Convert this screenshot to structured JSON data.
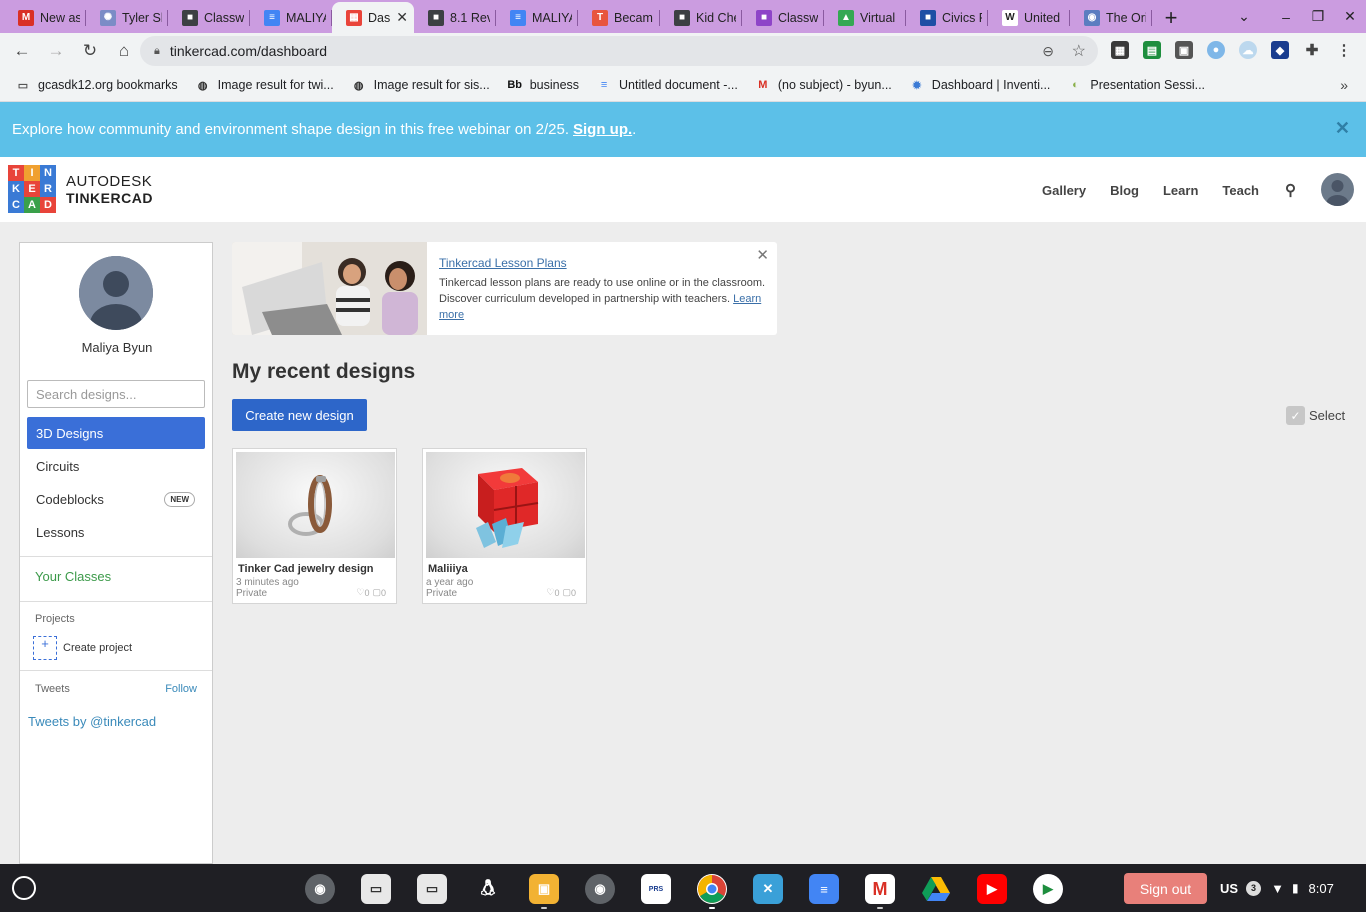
{
  "browser": {
    "tabs": [
      {
        "title": "New as",
        "icon": "gmail-icon",
        "color": "#d93025",
        "glyph": "M"
      },
      {
        "title": "Tyler Sl",
        "icon": "sparkle-icon",
        "color": "#7b8cc6",
        "glyph": "✺"
      },
      {
        "title": "Classw",
        "icon": "classroom-icon",
        "color": "#3c4043",
        "glyph": "■"
      },
      {
        "title": "MALIYA",
        "icon": "docs-icon",
        "color": "#4285f4",
        "glyph": "≡"
      },
      {
        "title": "Das",
        "icon": "tinkercad-icon",
        "color": "#e9443a",
        "glyph": "▦",
        "active": true
      },
      {
        "title": "8.1 Rev",
        "icon": "classroom-icon",
        "color": "#3c4043",
        "glyph": "■"
      },
      {
        "title": "MALIYA",
        "icon": "docs-icon",
        "color": "#4285f4",
        "glyph": "≡"
      },
      {
        "title": "Becam",
        "icon": "app-icon",
        "color": "#e8553e",
        "glyph": "T"
      },
      {
        "title": "Kid Che",
        "icon": "classroom-icon",
        "color": "#3c4043",
        "glyph": "■"
      },
      {
        "title": "Classw",
        "icon": "classroom-purple-icon",
        "color": "#8e44c8",
        "glyph": "■"
      },
      {
        "title": "Virtual",
        "icon": "drive-icon",
        "color": "#34a853",
        "glyph": "▲"
      },
      {
        "title": "Civics F",
        "icon": "slides-icon",
        "color": "#1e4fa5",
        "glyph": "■"
      },
      {
        "title": "United",
        "icon": "wikipedia-icon",
        "color": "#ffffff",
        "glyph": "W"
      },
      {
        "title": "The Ori",
        "icon": "globe-icon",
        "color": "#5b7dc0",
        "glyph": "◉"
      }
    ],
    "url": "tinkercad.com/dashboard",
    "bookmarks": [
      {
        "label": "gcasdk12.org bookmarks",
        "icon": "folder-icon"
      },
      {
        "label": "Image result for twi...",
        "icon": "globe-icon"
      },
      {
        "label": "Image result for sis...",
        "icon": "globe-icon"
      },
      {
        "label": "business",
        "icon": "blackboard-icon"
      },
      {
        "label": "Untitled document -...",
        "icon": "docs-icon"
      },
      {
        "label": "(no subject) - byun...",
        "icon": "gmail-icon"
      },
      {
        "label": "Dashboard | Inventi...",
        "icon": "gear-icon"
      },
      {
        "label": "Presentation Sessi...",
        "icon": "pear-icon"
      }
    ]
  },
  "banner": {
    "text": "Explore how community and environment shape design in this free webinar on 2/25.",
    "link": "Sign up.",
    "trail": "."
  },
  "header": {
    "logo_letters": [
      "T",
      "I",
      "N",
      "K",
      "E",
      "R",
      "C",
      "A",
      "D"
    ],
    "logo_colors": [
      "#e8443a",
      "#f0a030",
      "#3a7ad5",
      "#3a7ad5",
      "#e8443a",
      "#3a7ad5",
      "#3a7ad5",
      "#3aa04a",
      "#e8443a"
    ],
    "brand_top": "AUTODESK",
    "brand_bottom": "TINKERCAD",
    "nav": [
      "Gallery",
      "Blog",
      "Learn",
      "Teach"
    ]
  },
  "sidebar": {
    "user_name": "Maliya Byun",
    "search_placeholder": "Search designs...",
    "items": [
      {
        "label": "3D Designs",
        "active": true
      },
      {
        "label": "Circuits"
      },
      {
        "label": "Codeblocks",
        "badge": "NEW"
      },
      {
        "label": "Lessons"
      }
    ],
    "your_classes": "Your Classes",
    "projects_label": "Projects",
    "create_project": "Create project",
    "tweets_label": "Tweets",
    "follow": "Follow",
    "tweets_link": "Tweets by @tinkercad"
  },
  "lesson_card": {
    "title": "Tinkercad Lesson Plans",
    "description": "Tinkercad lesson plans are ready to use online or in the classroom. Discover curriculum developed in partnership with teachers.",
    "learn_more": "Learn more"
  },
  "main": {
    "title": "My recent designs",
    "create_button": "Create new design",
    "select_label": "Select",
    "designs": [
      {
        "name": "Tinker Cad jewelry design",
        "time": "3 minutes ago",
        "privacy": "Private",
        "likes": "0",
        "comments": "0"
      },
      {
        "name": "Maliiiya",
        "time": "a year ago",
        "privacy": "Private",
        "likes": "0",
        "comments": "0"
      }
    ]
  },
  "shelf": {
    "signout": "Sign out",
    "ime": "US",
    "notifications": "3",
    "time": "8:07"
  }
}
